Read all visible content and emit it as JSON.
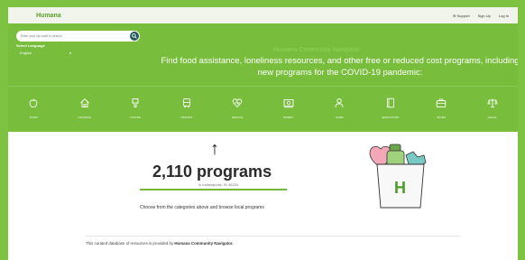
{
  "header": {
    "logo": "Humana",
    "links": [
      "Support",
      "Sign Up",
      "Log In"
    ]
  },
  "hero": {
    "search": {
      "placeholder": "Enter your zip code to search"
    },
    "language": {
      "label": "Select Language",
      "selected": "English"
    },
    "heading": "Humana Community Navigator",
    "text": "Find food assistance, loneliness resources, and other free or reduced cost programs, including new programs for the COVID-19 pandemic:"
  },
  "categories": [
    {
      "label": "FOOD",
      "icon": "apple-icon"
    },
    {
      "label": "HOUSING",
      "icon": "house-icon"
    },
    {
      "label": "GOODS",
      "icon": "shirt-icon"
    },
    {
      "label": "TRANSIT",
      "icon": "bus-icon"
    },
    {
      "label": "HEALTH",
      "icon": "heart-icon"
    },
    {
      "label": "MONEY",
      "icon": "money-icon"
    },
    {
      "label": "CARE",
      "icon": "care-icon"
    },
    {
      "label": "EDUCATION",
      "icon": "book-icon"
    },
    {
      "label": "WORK",
      "icon": "briefcase-icon"
    },
    {
      "label": "LEGAL",
      "icon": "scales-icon"
    }
  ],
  "results": {
    "count": "2,110 programs",
    "sub": "in Indianapolis, IN 46204",
    "choose": "Choose from the categories above and browse local programs"
  },
  "footer": {
    "note_prefix": "This curated database of resources is provided by",
    "note_brand": "Humana Community Navigator."
  },
  "colors": {
    "brand_green": "#78be3c",
    "outer_green": "#7ec242",
    "search_button": "#205a5d"
  }
}
